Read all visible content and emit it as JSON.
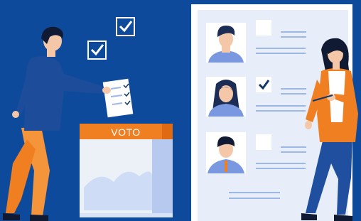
{
  "ballot_box": {
    "label": "VOTO"
  },
  "candidates": [
    {
      "role": "candidate-1",
      "checked": false
    },
    {
      "role": "candidate-2",
      "checked": true
    },
    {
      "role": "candidate-3",
      "checked": false
    }
  ],
  "colors": {
    "background": "#0d4a9c",
    "panel": "#e6ecf8",
    "panel_border": "#ffffff",
    "accent_orange": "#f07f22",
    "line_blue": "#9db8e6",
    "dark_navy": "#123766"
  },
  "icons": [
    "checkbox-checked-icon",
    "checkbox-checked-icon",
    "ballot-paper-icon"
  ]
}
